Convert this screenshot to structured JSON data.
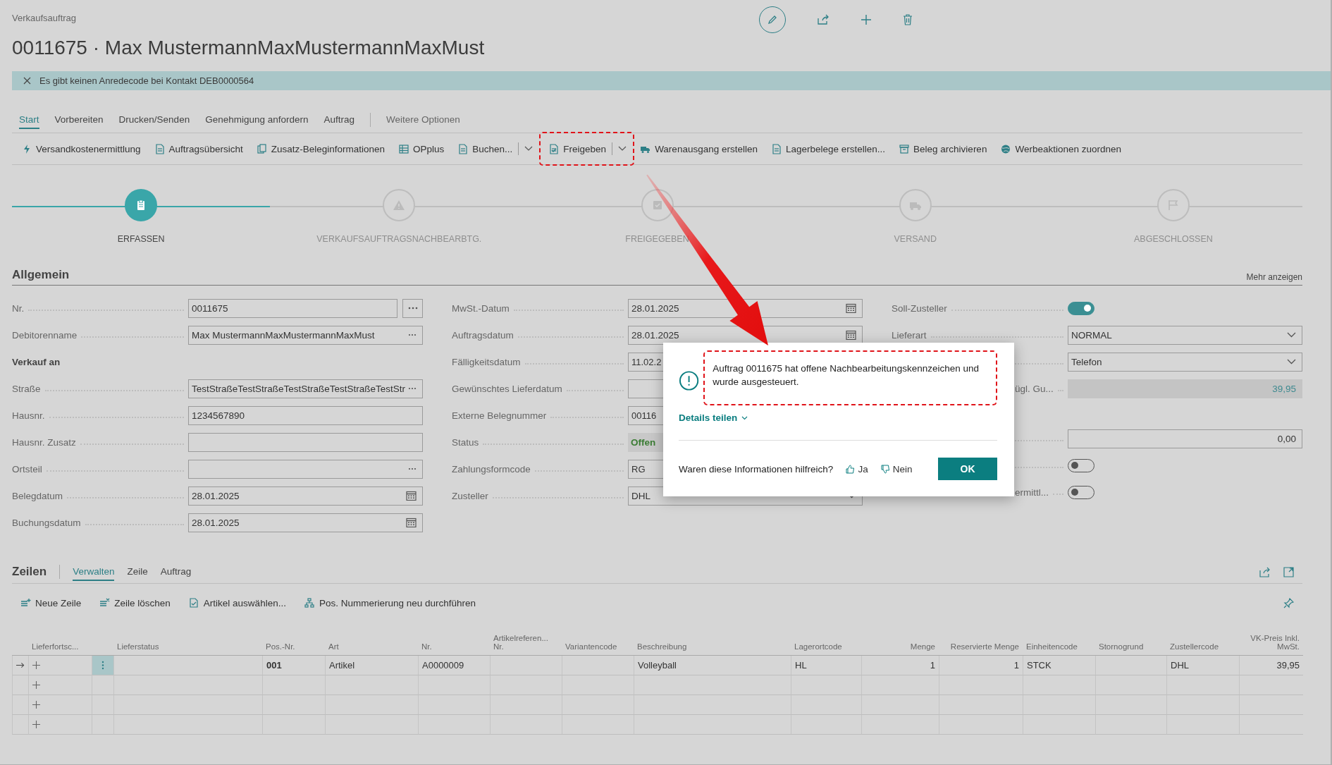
{
  "breadcrumb": "Verkaufsauftrag",
  "title": "0011675 · Max MustermannMaxMustermannMaxMust",
  "notification": {
    "message": "Es gibt keinen Anredecode bei Kontakt DEB0000564"
  },
  "tabs": [
    {
      "label": "Start",
      "selected": true
    },
    {
      "label": "Vorbereiten",
      "selected": false
    },
    {
      "label": "Drucken/Senden",
      "selected": false
    },
    {
      "label": "Genehmigung anfordern",
      "selected": false
    },
    {
      "label": "Auftrag",
      "selected": false
    }
  ],
  "more_tab": "Weitere Optionen",
  "actions": [
    {
      "label": "Versandkostenermittlung",
      "split": false,
      "annotated": false
    },
    {
      "label": "Auftragsübersicht",
      "split": false,
      "annotated": false
    },
    {
      "label": "Zusatz-Beleginformationen",
      "split": false,
      "annotated": false
    },
    {
      "label": "OPplus",
      "split": false,
      "annotated": false
    },
    {
      "label": "Buchen...",
      "split": true,
      "annotated": false
    },
    {
      "label": "Freigeben",
      "split": true,
      "annotated": true
    },
    {
      "label": "Warenausgang erstellen",
      "split": false,
      "annotated": false
    },
    {
      "label": "Lagerbelege erstellen...",
      "split": false,
      "annotated": false
    },
    {
      "label": "Beleg archivieren",
      "split": false,
      "annotated": false
    },
    {
      "label": "Werbeaktionen zuordnen",
      "split": false,
      "annotated": false
    }
  ],
  "stages": [
    {
      "label": "ERFASSEN",
      "current": true
    },
    {
      "label": "VERKAUFSAUFTRAGSNACHBEARBTG.",
      "current": false
    },
    {
      "label": "FREIGEGEBEN",
      "current": false
    },
    {
      "label": "VERSAND",
      "current": false
    },
    {
      "label": "ABGESCHLOSSEN",
      "current": false
    }
  ],
  "general": {
    "title": "Allgemein",
    "more": "Mehr anzeigen",
    "left": [
      {
        "label": "Nr.",
        "kind": "text_button",
        "value": "0011675"
      },
      {
        "label": "Debitorenname",
        "kind": "lookup",
        "value": "Max MustermannMaxMustermannMaxMust"
      },
      {
        "label": "Verkauf an",
        "kind": "heading"
      },
      {
        "label": "Straße",
        "kind": "lookup",
        "value": "TestStraßeTestStraßeTestStraßeTestStraßeTestStr"
      },
      {
        "label": "Hausnr.",
        "kind": "text",
        "value": "1234567890"
      },
      {
        "label": "Hausnr. Zusatz",
        "kind": "text"
      },
      {
        "label": "Ortsteil",
        "kind": "lookup"
      },
      {
        "label": "Belegdatum",
        "kind": "date",
        "value": "28.01.2025"
      },
      {
        "label": "Buchungsdatum",
        "kind": "date",
        "value": "28.01.2025"
      }
    ],
    "middle": [
      {
        "label": "MwSt.-Datum",
        "kind": "date",
        "value": "28.01.2025"
      },
      {
        "label": "Auftragsdatum",
        "kind": "date",
        "value": "28.01.2025"
      },
      {
        "label": "Fälligkeitsdatum",
        "kind": "text",
        "value": "11.02.2"
      },
      {
        "label": "Gewünschtes Lieferdatum",
        "kind": "text"
      },
      {
        "label": "Externe Belegnummer",
        "kind": "text",
        "value": "00116"
      },
      {
        "label": "Status",
        "kind": "status",
        "value": "Offen"
      },
      {
        "label": "Zahlungsformcode",
        "kind": "text",
        "value": "RG"
      },
      {
        "label": "Zusteller",
        "kind": "select",
        "value": "DHL"
      }
    ],
    "right": [
      {
        "label": "Soll-Zusteller",
        "kind": "toggle",
        "on": true
      },
      {
        "label": "Lieferart",
        "kind": "select",
        "value": "NORMAL"
      },
      {
        "kind": "select",
        "value": "Telefon"
      },
      {
        "label": "ügl. Gu...",
        "kind": "readonly",
        "value": "39,95"
      },
      {
        "kind": "number",
        "value": "0,00"
      },
      {
        "kind": "toggle",
        "on": false
      },
      {
        "label": "ermittl...",
        "kind": "toggle",
        "on": false
      }
    ]
  },
  "dialog": {
    "message": "Auftrag 0011675 hat offene Nachbearbeitungskennzeichen und wurde ausgesteuert.",
    "annotated": true,
    "details": "Details teilen",
    "question": "Waren diese Informationen hilfreich?",
    "yes": "Ja",
    "no": "Nein",
    "ok": "OK"
  },
  "lines": {
    "title": "Zeilen",
    "tabs": [
      {
        "label": "Verwalten",
        "selected": true
      },
      {
        "label": "Zeile",
        "selected": false
      },
      {
        "label": "Auftrag",
        "selected": false
      }
    ],
    "actions": [
      "Neue Zeile",
      "Zeile löschen",
      "Artikel auswählen...",
      "Pos. Nummerierung neu durchführen"
    ],
    "columns": [
      {
        "label": "Lieferfortsc...",
        "kind": "text"
      },
      {
        "label": "Lieferstatus",
        "kind": "text"
      },
      {
        "label": "Pos.-Nr.",
        "kind": "code"
      },
      {
        "label": "Art",
        "kind": "text"
      },
      {
        "label": "Nr.",
        "kind": "text"
      },
      {
        "label": "Artikelreferen... Nr.",
        "kind": "text"
      },
      {
        "label": "Variantencode",
        "kind": "text"
      },
      {
        "label": "Beschreibung",
        "kind": "text"
      },
      {
        "label": "Lagerortcode",
        "kind": "text"
      },
      {
        "label": "Menge",
        "kind": "number"
      },
      {
        "label": "Reservierte Menge",
        "kind": "number"
      },
      {
        "label": "Einheitencode",
        "kind": "text"
      },
      {
        "label": "Stornogrund",
        "kind": "text"
      },
      {
        "label": "Zustellercode",
        "kind": "text"
      },
      {
        "label": "VK-Preis Inkl. MwSt.",
        "kind": "number"
      }
    ],
    "rows": [
      {
        "current": true,
        "cells": [
          null,
          null,
          "001",
          "Artikel",
          "A0000009",
          null,
          null,
          "Volleyball",
          "HL",
          "1",
          "1",
          "STCK",
          null,
          "DHL",
          "39,95"
        ]
      },
      {
        "current": false
      },
      {
        "current": false
      },
      {
        "current": false
      }
    ]
  }
}
